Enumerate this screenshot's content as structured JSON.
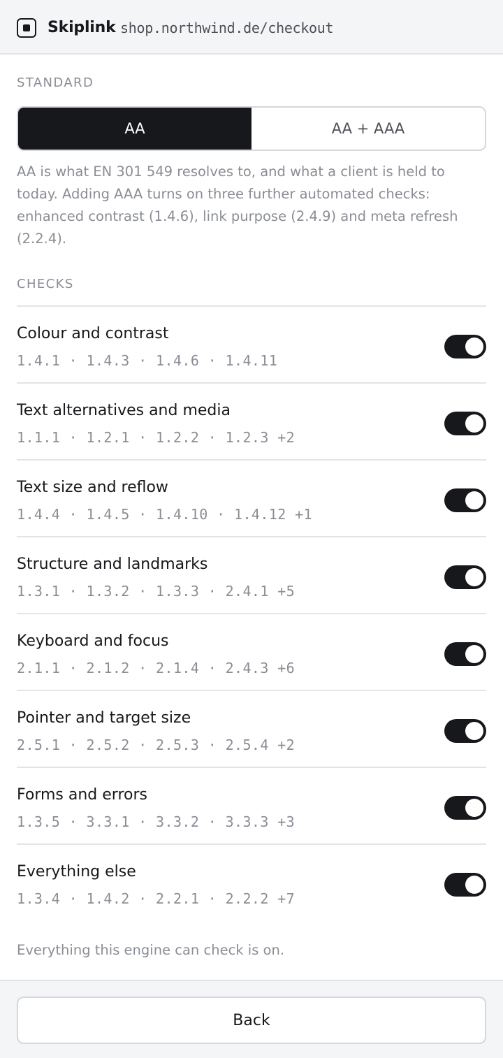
{
  "header": {
    "brand": "Skiplink",
    "url": "shop.northwind.de/checkout",
    "logo_icon": "square-logo-icon"
  },
  "standard": {
    "label": "STANDARD",
    "options": [
      "AA",
      "AA + AAA"
    ],
    "selected": "AA",
    "description": "AA is what EN 301 549 resolves to, and what a client is held to today. Adding AAA turns on three further automated checks: enhanced contrast (1.4.6), link purpose (2.4.9) and meta refresh (2.2.4)."
  },
  "checks": {
    "label": "CHECKS",
    "items": [
      {
        "title": "Colour and contrast",
        "codes": "1.4.1 · 1.4.3 · 1.4.6 · 1.4.11",
        "enabled": true
      },
      {
        "title": "Text alternatives and media",
        "codes": "1.1.1 · 1.2.1 · 1.2.2 · 1.2.3 +2",
        "enabled": true
      },
      {
        "title": "Text size and reflow",
        "codes": "1.4.4 · 1.4.5 · 1.4.10 · 1.4.12 +1",
        "enabled": true
      },
      {
        "title": "Structure and landmarks",
        "codes": "1.3.1 · 1.3.2 · 1.3.3 · 2.4.1 +5",
        "enabled": true
      },
      {
        "title": "Keyboard and focus",
        "codes": "2.1.1 · 2.1.2 · 2.1.4 · 2.4.3 +6",
        "enabled": true
      },
      {
        "title": "Pointer and target size",
        "codes": "2.5.1 · 2.5.2 · 2.5.3 · 2.5.4 +2",
        "enabled": true
      },
      {
        "title": "Forms and errors",
        "codes": "1.3.5 · 3.3.1 · 3.3.2 · 3.3.3 +3",
        "enabled": true
      },
      {
        "title": "Everything else",
        "codes": "1.3.4 · 1.4.2 · 2.2.1 · 2.2.2 +7",
        "enabled": true
      }
    ],
    "footnote": "Everything this engine can check is on."
  },
  "footer": {
    "back_label": "Back"
  },
  "colors": {
    "accent": "#17181b",
    "muted_text": "#8a8d94",
    "header_bg": "#f4f5f7",
    "border": "#e3e4e8"
  }
}
